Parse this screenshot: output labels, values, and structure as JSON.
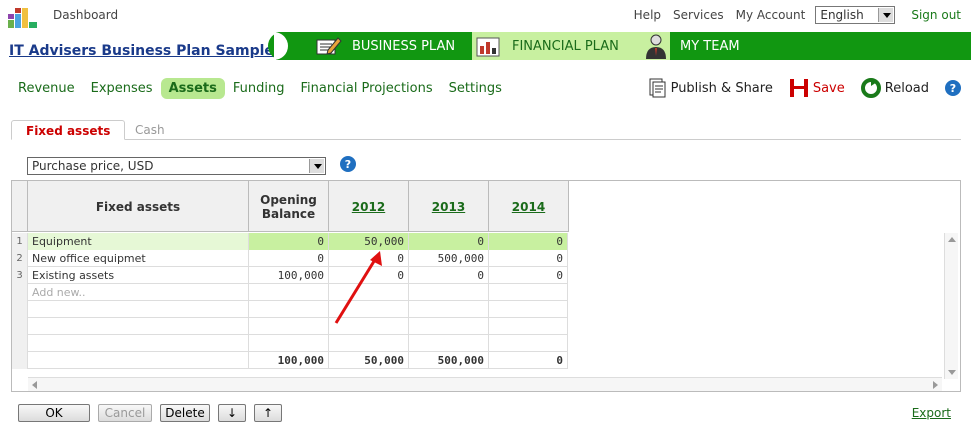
{
  "topbar": {
    "dashboard": "Dashboard",
    "help": "Help",
    "services": "Services",
    "my_account": "My Account",
    "language": "English",
    "sign_out": "Sign out"
  },
  "header": {
    "plan_title": "IT Advisers Business Plan Sample",
    "tabs": [
      {
        "label": "BUSINESS PLAN"
      },
      {
        "label": "FINANCIAL PLAN"
      },
      {
        "label": "MY TEAM"
      }
    ]
  },
  "subnav": {
    "items": [
      {
        "label": "Revenue"
      },
      {
        "label": "Expenses"
      },
      {
        "label": "Assets"
      },
      {
        "label": "Funding"
      },
      {
        "label": "Financial Projections"
      },
      {
        "label": "Settings"
      }
    ]
  },
  "actions": {
    "publish": "Publish & Share",
    "save": "Save",
    "reload": "Reload",
    "help": "?"
  },
  "tabs": {
    "fixed": "Fixed assets",
    "cash": "Cash"
  },
  "dropdown": {
    "value": "Purchase price, USD",
    "help": "?"
  },
  "grid": {
    "headers": {
      "name": "Fixed assets",
      "opening": "Opening Balance",
      "y1": "2012",
      "y2": "2013",
      "y3": "2014"
    },
    "rows": [
      {
        "idx": "1",
        "name": "Equipment",
        "opening": "0",
        "y1": "50,000",
        "y2": "0",
        "y3": "0"
      },
      {
        "idx": "2",
        "name": "New office equipmet",
        "opening": "0",
        "y1": "0",
        "y2": "500,000",
        "y3": "0"
      },
      {
        "idx": "3",
        "name": "Existing assets",
        "opening": "100,000",
        "y1": "0",
        "y2": "0",
        "y3": "0"
      }
    ],
    "add_new": "Add new..",
    "totals": {
      "opening": "100,000",
      "y1": "50,000",
      "y2": "500,000",
      "y3": "0"
    }
  },
  "buttons": {
    "ok": "OK",
    "cancel": "Cancel",
    "delete": "Delete",
    "down": "↓",
    "up": "↑",
    "export": "Export"
  },
  "colors": {
    "brand_green": "#119711",
    "active_tab": "#c8f0a0",
    "save_red": "#cc0000"
  }
}
